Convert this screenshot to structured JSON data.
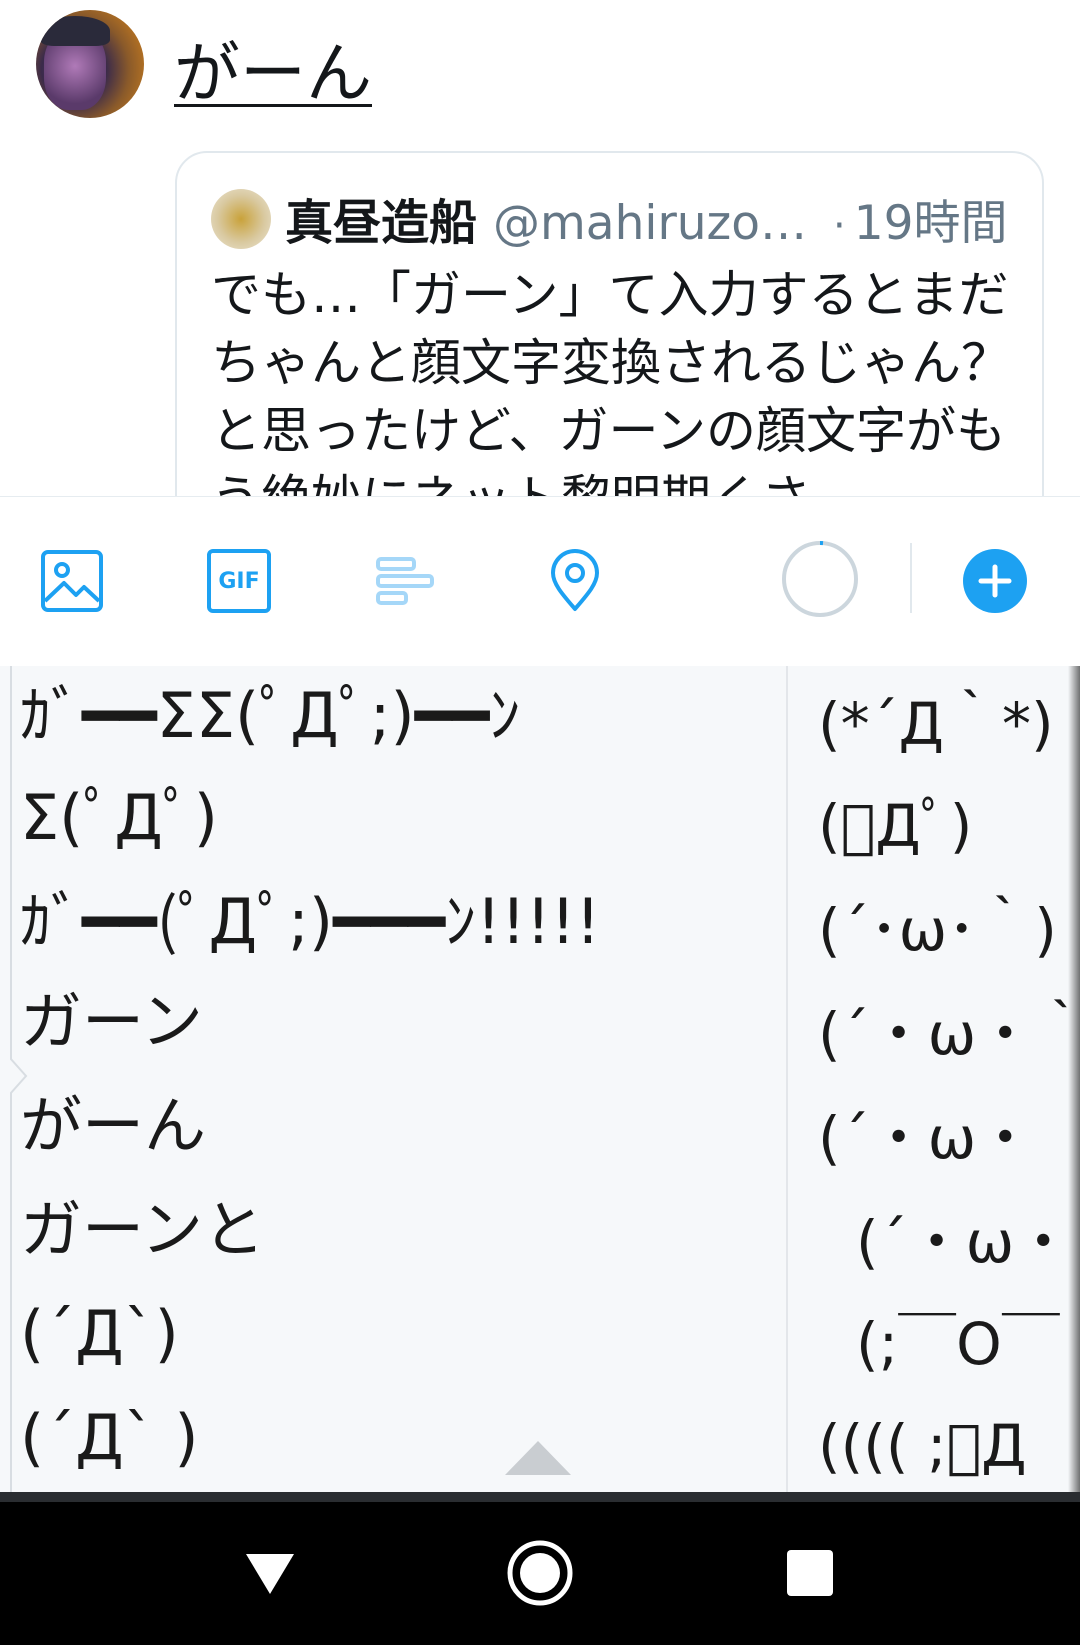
{
  "compose": {
    "draft_text": "がーん",
    "avatar_alt": "user-avatar"
  },
  "quote": {
    "name": "真昼造船",
    "handle": "@mahiruzo…",
    "separator": "·",
    "time": "19時間",
    "body": "でも…「ガーン」て入力するとまだちゃんと顔文字変換されるじゃん？と思ったけど、ガーンの顔文字がもう絶妙にネット黎明期くさ"
  },
  "toolbar": {
    "icons": [
      "image-icon",
      "gif-icon",
      "poll-icon",
      "location-icon",
      "progress-ring-icon",
      "add-tweet-icon"
    ],
    "gif_label": "GIF",
    "accent": "#1da1f2"
  },
  "keyboard": {
    "candidates_left": [
      "ｶﾞ━━ΣΣ(ﾟДﾟ;)━━ﾝ",
      "Σ(ﾟДﾟ)",
      "ｶﾞ━━(ﾟДﾟ;)━━━ﾝ!!!!!",
      "ガーン",
      "がーん",
      "ガーンと",
      "(´Д`)",
      "(´Д` )"
    ],
    "candidates_right": [
      "(*´Д｀*)",
      "(ﾟДﾟ)",
      "(´･ω･｀)",
      "(´・ω・｀)",
      "(´・ω・",
      "(´・ω・",
      "(;￣O￣",
      "(((( ;ﾟД"
    ]
  },
  "navbar": {
    "buttons": [
      "back-button",
      "home-button",
      "recents-button"
    ]
  }
}
